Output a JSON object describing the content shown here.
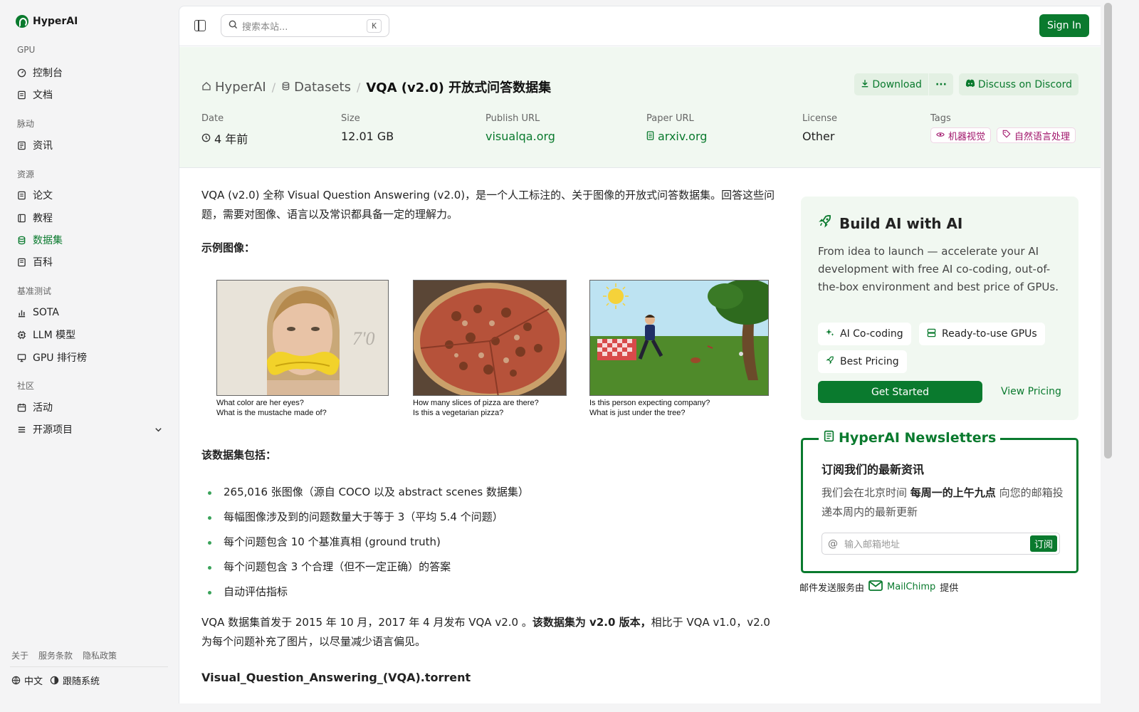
{
  "brand": {
    "name": "HyperAI"
  },
  "sidebar": {
    "sections": [
      {
        "title": "GPU",
        "items": [
          {
            "label": "控制台",
            "icon": "gauge-icon"
          },
          {
            "label": "文档",
            "icon": "doc-icon"
          }
        ]
      },
      {
        "title": "脉动",
        "items": [
          {
            "label": "资讯",
            "icon": "news-icon"
          }
        ]
      },
      {
        "title": "资源",
        "items": [
          {
            "label": "论文",
            "icon": "paper-icon"
          },
          {
            "label": "教程",
            "icon": "book-icon"
          },
          {
            "label": "数据集",
            "icon": "database-icon",
            "active": true
          },
          {
            "label": "百科",
            "icon": "wiki-icon"
          }
        ]
      },
      {
        "title": "基准测试",
        "items": [
          {
            "label": "SOTA",
            "icon": "chart-icon"
          },
          {
            "label": "LLM 模型",
            "icon": "cpu-icon"
          },
          {
            "label": "GPU 排行榜",
            "icon": "monitor-icon"
          }
        ]
      },
      {
        "title": "社区",
        "items": [
          {
            "label": "活动",
            "icon": "calendar-icon"
          },
          {
            "label": "开源项目",
            "icon": "list-icon"
          }
        ]
      }
    ],
    "footer_links": [
      "关于",
      "服务条款",
      "隐私政策"
    ],
    "language": "中文",
    "tracking": "跟随系统"
  },
  "topbar": {
    "search_placeholder": "搜索本站...",
    "shortcut": " K",
    "signin": "Sign In"
  },
  "header": {
    "breadcrumbs": [
      "HyperAI",
      "Datasets",
      "VQA (v2.0) 开放式问答数据集"
    ],
    "download_label": "Download",
    "more_label": "···",
    "discord_label": "Discuss on Discord",
    "meta": {
      "date_label": "Date",
      "date_value": "4 年前",
      "size_label": "Size",
      "size_value": "12.01 GB",
      "publish_label": "Publish URL",
      "publish_value": "visualqa.org",
      "paper_label": "Paper URL",
      "paper_value": "arxiv.org",
      "license_label": "License",
      "license_value": "Other",
      "tags_label": "Tags",
      "tags": [
        "机器视觉",
        "自然语言处理"
      ]
    }
  },
  "content": {
    "intro": "VQA (v2.0) 全称 Visual Question Answering (v2.0)，是一个人工标注的、关于图像的开放式问答数据集。回答这些问题，需要对图像、语言以及常识都具备一定的理解力。",
    "example_heading": "示例图像：",
    "examples": [
      {
        "q1": "What color are her eyes?",
        "q2": "What is the mustache made of?"
      },
      {
        "q1": "How many slices of pizza are there?",
        "q2": "Is this a vegetarian pizza?"
      },
      {
        "q1": "Is this person expecting company?",
        "q2": "What is just under the tree?"
      }
    ],
    "includes_heading": "该数据集包括：",
    "includes": [
      "265,016 张图像（源自 COCO 以及 abstract scenes 数据集）",
      "每幅图像涉及到的问题数量大于等于 3（平均 5.4 个问题）",
      "每个问题包含 10 个基准真相 (ground truth)",
      "每个问题包含 3 个合理（但不一定正确）的答案",
      "自动评估指标"
    ],
    "release_prefix": "VQA 数据集首发于 2015 年 10 月，2017 年 4 月发布 VQA v2.0 。",
    "release_bold": "该数据集为 v2.0 版本，",
    "release_suffix": "相比于 VQA v1.0，v2.0 为每个问题补充了图片，以尽量减少语言偏见。",
    "torrent": "Visual_Question_Answering_(VQA).torrent"
  },
  "promo": {
    "title": "Build AI with AI",
    "desc": "From idea to launch — accelerate your AI development with free AI co-coding, out-of-the-box environment and best price of GPUs.",
    "features": [
      "AI Co-coding",
      "Ready-to-use GPUs",
      "Best Pricing"
    ],
    "cta": "Get Started",
    "pricing": "View Pricing"
  },
  "newsletter": {
    "legend": "HyperAI Newsletters",
    "heading": "订阅我们的最新资讯",
    "text_prefix": "我们会在北京时间 ",
    "text_bold": "每周一的上午九点",
    "text_suffix": " 向您的邮箱投递本周内的最新更新",
    "email_placeholder": "输入邮箱地址",
    "subscribe": "订阅",
    "mail_prefix": "邮件发送服务由",
    "mail_provider": "MailChimp",
    "mail_suffix": "提供"
  },
  "colors": {
    "accent": "#0a7a2e",
    "tag": "#a0136a"
  }
}
